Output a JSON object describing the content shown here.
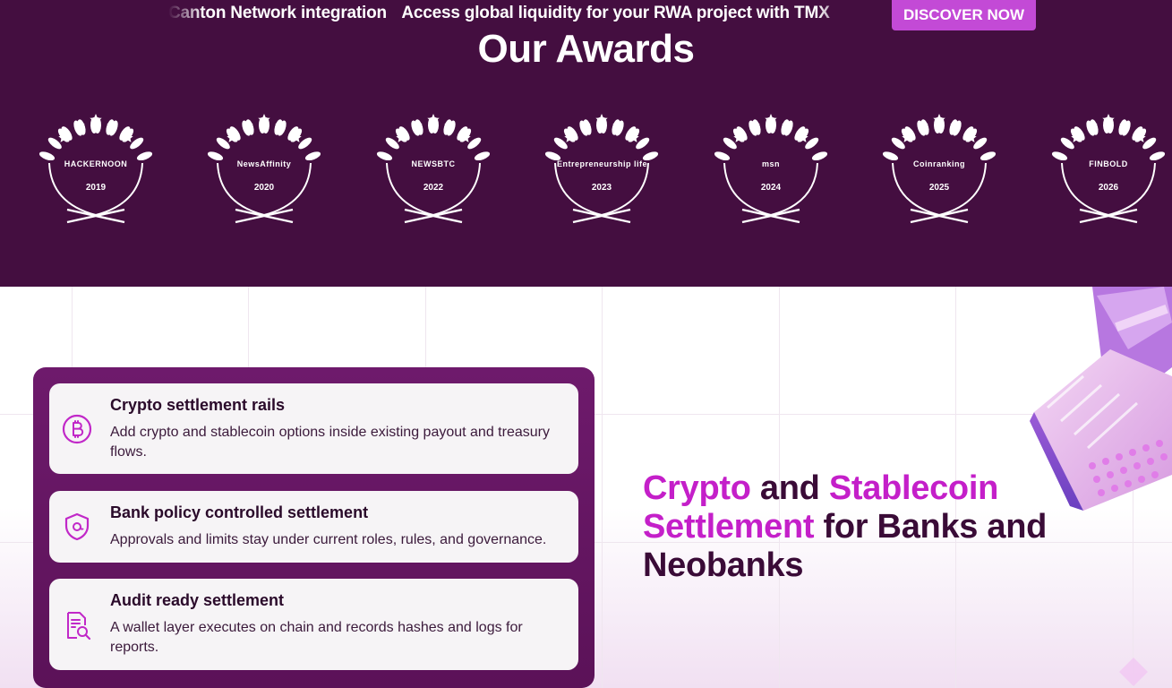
{
  "ticker": {
    "items": [
      "Canton Network integration",
      "Access global liquidity for your RWA project with TMX"
    ]
  },
  "cta": {
    "discover_label": "DISCOVER NOW"
  },
  "awards": {
    "title": "Our Awards",
    "badges": [
      {
        "logo": "HACKERNOON",
        "year": "2019",
        "icon": "hackernoon-logo-icon"
      },
      {
        "logo": "NewsAffinity",
        "year": "2020",
        "icon": "newsaffinity-logo-icon"
      },
      {
        "logo": "NEWSBTC",
        "year": "2022",
        "icon": "newsbtc-logo-icon"
      },
      {
        "logo": "Entrepreneurship life",
        "year": "2023",
        "icon": "entrepreneurship-life-logo-icon"
      },
      {
        "logo": "msn",
        "year": "2024",
        "icon": "msn-logo-icon"
      },
      {
        "logo": "Coinranking",
        "year": "2025",
        "icon": "coinranking-logo-icon"
      },
      {
        "logo": "FINBOLD",
        "year": "2026",
        "icon": "finbold-logo-icon"
      }
    ]
  },
  "features": [
    {
      "title": "Crypto settlement rails",
      "description": "Add crypto and stablecoin options inside existing payout and treasury flows.",
      "icon": "bitcoin-icon"
    },
    {
      "title": "Bank policy controlled settlement",
      "description": "Approvals and limits stay under current roles, rules, and governance.",
      "icon": "shield-icon"
    },
    {
      "title": "Audit ready settlement",
      "description": "A wallet layer executes on chain and records hashes and logs for reports.",
      "icon": "document-search-icon"
    }
  ],
  "headline": {
    "part1": "Crypto",
    "part2": " and ",
    "part3": "Stablecoin Settlement",
    "part4": " for Banks and Neobanks"
  },
  "colors": {
    "awards_bg": "#440e40",
    "accent": "#c41fc9",
    "button": "#c34ad6",
    "panel": "#6e1a6c",
    "heading": "#3a0b37"
  }
}
